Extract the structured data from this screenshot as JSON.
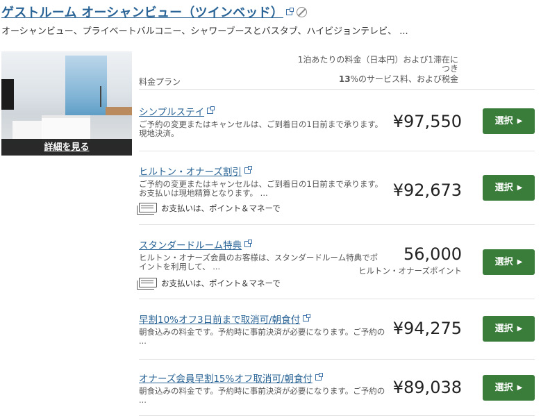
{
  "room": {
    "title": "ゲストルーム オーシャンビュー（ツインベッド）",
    "amenities": "オーシャンビュー、プライベートバルコニー、シャワーブースとバスタブ、ハイビジョンテレビ、 ...",
    "photo_link": "詳細を見る"
  },
  "header": {
    "plan_col": "料金プラン",
    "price_line1": "1泊あたりの料金（日本円）および1滞在に",
    "price_line2": "つき",
    "price_line3_pct": "13",
    "price_line3_rest": "%のサービス料、および税金"
  },
  "select_label": "選択",
  "plans": [
    {
      "name": "シンプルステイ",
      "desc": "ご予約の変更またはキャンセルは、ご到着日の1日前まで承ります。現地決済。",
      "price": "¥97,550"
    },
    {
      "name": "ヒルトン・オナーズ割引",
      "desc": "ご予約の変更またはキャンセルは、ご到着日の1日前まで承ります。お支払いは現地精算となります。 ...",
      "payment": "お支払いは、ポイント＆マネーで",
      "price": "¥92,673"
    },
    {
      "name": "スタンダードルーム特典",
      "desc": "ヒルトン・オナーズ会員のお客様は、スタンダードルーム特典でポイントを利用して、 ...",
      "payment": "お支払いは、ポイント＆マネーで",
      "price": "56,000",
      "price_unit": "ヒルトン・オナーズポイント"
    },
    {
      "name": "早割10%オフ3日前まで取消可/朝食付",
      "desc": "朝食込みの料金です。予約時に事前決済が必要になります。ご予約の ...",
      "price": "¥94,275"
    },
    {
      "name": "オナーズ会員早割15%オフ取消可/朝食付",
      "desc": "朝食込みの料金です。予約時に事前決済が必要になります。ご予約の ...",
      "price": "¥89,038"
    }
  ]
}
